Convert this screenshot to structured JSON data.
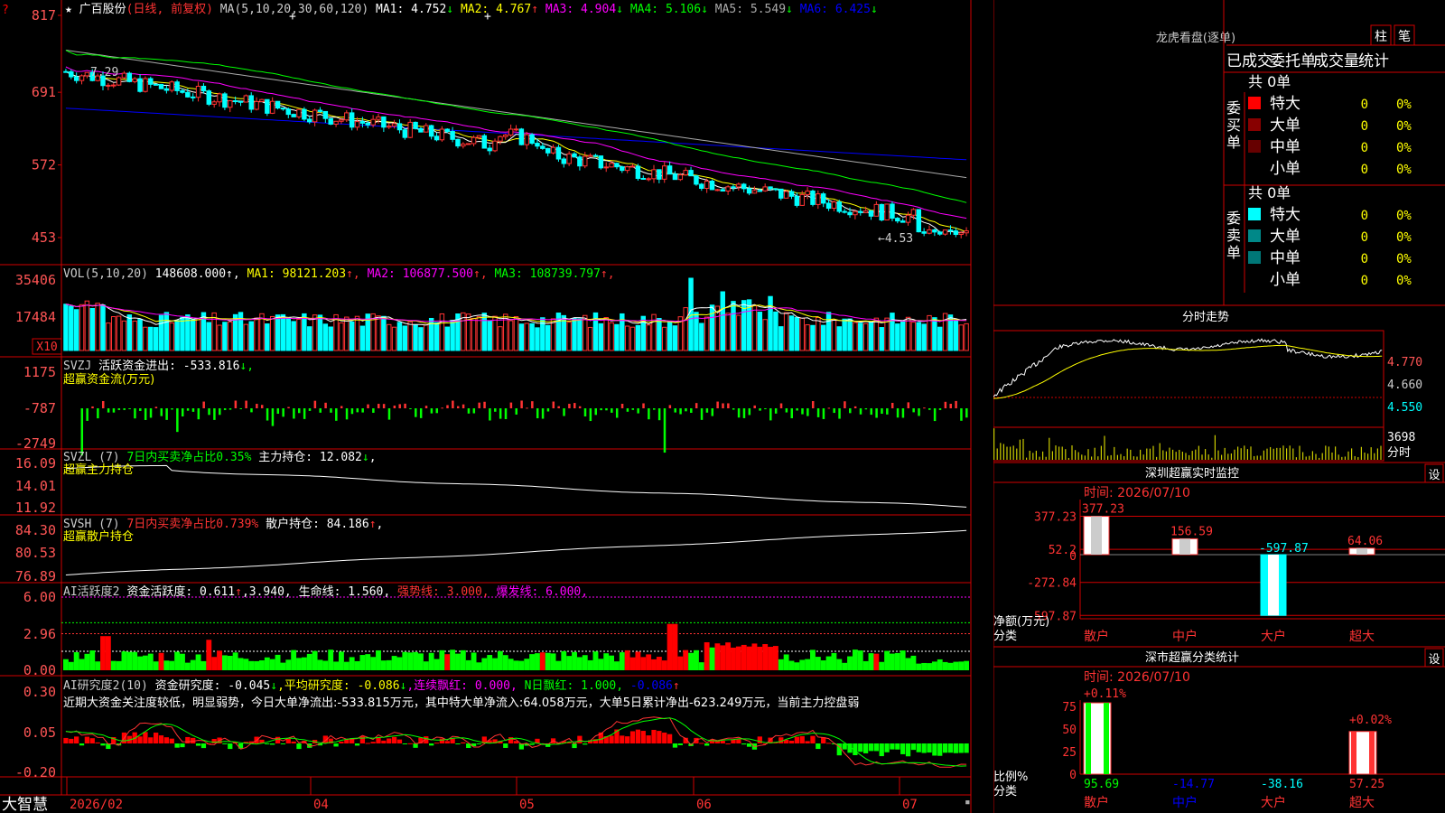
{
  "app": {
    "brand": "大智慧"
  },
  "colors": {
    "up": "#ff3333",
    "down": "#00ffff",
    "ma1": "#ffffff",
    "ma2": "#ffff00",
    "ma3": "#ff00ff",
    "ma4": "#00ff00",
    "ma5": "#aaaaaa",
    "ma6": "#0000ff",
    "grid": "#b00000",
    "frame": "#d00000",
    "label": "#ff5555"
  },
  "kline": {
    "star": "★",
    "name": "广百股份",
    "period": "(日线, 前复权)",
    "ma_spec": "MA(5,10,20,30,60,120)",
    "ma": [
      {
        "label": "MA1:",
        "value": "4.752",
        "arrow": "↓"
      },
      {
        "label": "MA2:",
        "value": "4.767",
        "arrow": "↑"
      },
      {
        "label": "MA3:",
        "value": "4.904",
        "arrow": "↓"
      },
      {
        "label": "MA4:",
        "value": "5.106",
        "arrow": "↓"
      },
      {
        "label": "MA5:",
        "value": "5.549",
        "arrow": "↓"
      },
      {
        "label": "MA6:",
        "value": "6.425",
        "arrow": "↓"
      }
    ],
    "yticks": [
      "817",
      "691",
      "572",
      "453"
    ],
    "yvals": [
      8.17,
      6.91,
      5.72,
      4.53
    ],
    "high_mark": "7.29",
    "low_mark": "←4.53",
    "corner": "?"
  },
  "volume": {
    "title": "VOL(5,10,20)",
    "value": "148608.000",
    "ma": [
      {
        "label": "MA1:",
        "value": "98121.203",
        "arrow": "↑"
      },
      {
        "label": "MA2:",
        "value": "106877.500",
        "arrow": "↑"
      },
      {
        "label": "MA3:",
        "value": "108739.797",
        "arrow": "↑"
      }
    ],
    "yticks": [
      "35406",
      "17484"
    ],
    "unit": "X10"
  },
  "svzj": {
    "title": "SVZJ",
    "label": "活跃资金进出:",
    "value": "-533.816",
    "arrow": "↓",
    "subtitle": "超赢资金流(万元)",
    "yticks": [
      "1175",
      "-787",
      "-2749"
    ]
  },
  "svzl": {
    "title": "SVZL (7)",
    "ratio": "7日内买卖净占比0.35%",
    "label": "主力持仓:",
    "value": "12.082",
    "arrow": "↓",
    "tail": ",",
    "subtitle": "超赢主力持仓",
    "yticks": [
      "16.09",
      "14.01",
      "11.92"
    ]
  },
  "svsh": {
    "title": "SVSH (7)",
    "ratio": "7日内买卖净占比0.739%",
    "label": "散户持仓:",
    "value": "84.186",
    "arrow": "↑",
    "tail": ",",
    "subtitle": "超赢散户持仓",
    "yticks": [
      "84.30",
      "80.53",
      "76.89"
    ]
  },
  "ai1": {
    "title": "AI活跃度2",
    "label": "资金活跃度:",
    "v1": "0.611",
    "a1": "↑",
    "v2": ",3.940,",
    "label2": "生命线:",
    "v3": "1.560,",
    "l4": "强势线:",
    "v4": "3.000,",
    "l5": "爆发线:",
    "v5": "6.000,",
    "yticks": [
      "6.00",
      "2.96",
      "0.00"
    ]
  },
  "ai2": {
    "title": "AI研究度2(10)",
    "label": "资金研究度:",
    "v1": "-0.045",
    "a1": "↓",
    "l2": ",平均研究度:",
    "v2": "-0.086",
    "a2": "↓",
    "l3": ",连续飘红:",
    "v3": "0.000,",
    "l4": "N日飘红:",
    "v4": "1.000,",
    "v5": "-0.086",
    "a5": "↑",
    "comment": "近期大资金关注度较低，明显弱势，今日大单净流出:-533.815万元，其中特大单净流入:64.058万元，大单5日累计净出-623.249万元，当前主力控盘弱",
    "yticks": [
      "0.30",
      "0.05",
      "-0.20"
    ]
  },
  "dates": [
    "2026/02",
    "04",
    "05",
    "06",
    "07"
  ],
  "side": {
    "dragon_title": "龙虎看盘(逐单)",
    "btn1": "柱",
    "btn2": "笔",
    "tabs": [
      "已成交",
      "委托单",
      "成交量",
      "统计"
    ],
    "buy_side": "委买单",
    "sell_side": "委卖单",
    "buy_total": "共 0单",
    "sell_total": "共 0单",
    "rows": [
      {
        "name": "特大",
        "count": "0",
        "pct": "0%"
      },
      {
        "name": "大单",
        "count": "0",
        "pct": "0%"
      },
      {
        "name": "中单",
        "count": "0",
        "pct": "0%"
      },
      {
        "name": "小单",
        "count": "0",
        "pct": "0%"
      }
    ],
    "fenshi_title": "分时走势",
    "fenshi_prices": [
      "4.770",
      "4.660",
      "4.550"
    ],
    "fenshi_vol": "3698",
    "fenshi_unit": "分时",
    "sz_monitor_title": "深圳超赢实时监控",
    "set": "设",
    "monitor_time": "时间: 2026/07/10",
    "monitor_yticks": [
      "377.23",
      "52.2",
      "0",
      "-272.84",
      "-597.87"
    ],
    "monitor_unit": "净额(万元)",
    "monitor_cat": "分类",
    "monitor_bars": [
      {
        "cat": "散户",
        "value": 377.23,
        "label": "377.23"
      },
      {
        "cat": "中户",
        "value": 156.59,
        "label": "156.59"
      },
      {
        "cat": "大户",
        "value": -597.87,
        "label": "-597.87"
      },
      {
        "cat": "超大",
        "value": 64.06,
        "label": "64.06"
      }
    ],
    "stat_title": "深市超赢分类统计",
    "stat_time": "时间: 2026/07/10",
    "stat_yticks": [
      "75",
      "50",
      "25",
      "0"
    ],
    "stat_unit": "比例%",
    "stat_cat": "分类",
    "stat_top": [
      "+0.11%",
      "+0.02%"
    ],
    "stat_bars": [
      {
        "cat": "散户",
        "value": "95.69"
      },
      {
        "cat": "中户",
        "value": "-14.77"
      },
      {
        "cat": "大户",
        "value": "-38.16"
      },
      {
        "cat": "超大",
        "value": "57.25"
      }
    ]
  }
}
